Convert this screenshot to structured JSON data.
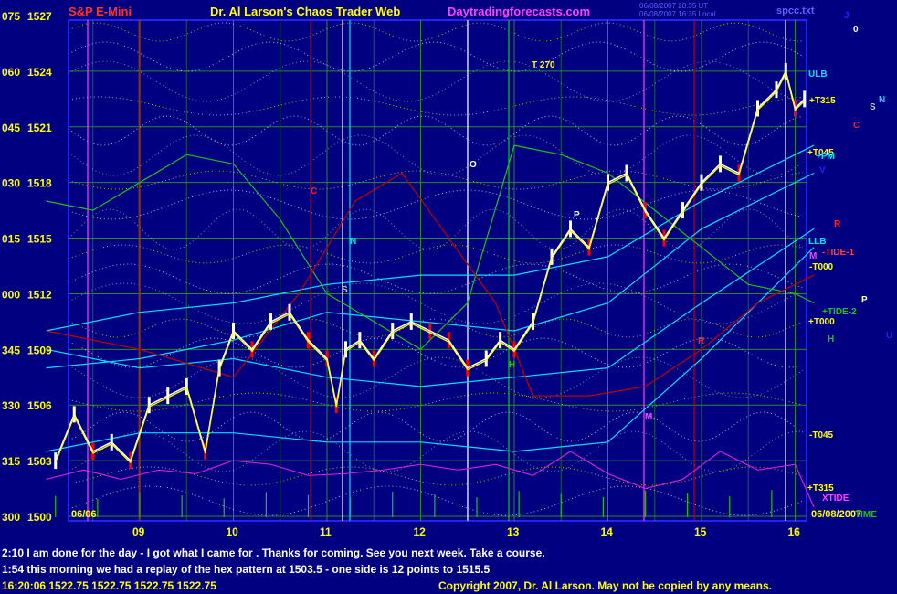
{
  "header": {
    "title_left": "S&P E-Mini",
    "title_center": "Dr. Al Larson's Chaos Trader Web",
    "site": "Daytradingforecasts.com",
    "timestamp_1": "06/08/2007 20:35 UT",
    "timestamp_2": "06/08/2007 16:35 Local",
    "file": "spcc.txt"
  },
  "colors": {
    "background": "#000080",
    "grid_green": "#2a8a2a",
    "axis_blue": "#2222ff",
    "title_red": "#ff3030",
    "title_yellow": "#ffff00",
    "site_magenta": "#ff40ff",
    "price_white": "#ffffff",
    "price_red": "#ff0000",
    "emf_yellow": "#ffff00",
    "tide_cyan": "#00e0ff",
    "tide_green": "#20c020",
    "tide_red": "#c00000",
    "xtide_magenta": "#d020d0"
  },
  "chart_data": {
    "type": "line",
    "title": "S&P E-Mini",
    "ylim": [
      1500,
      1527
    ],
    "y_ticks": [
      {
        "left": "075",
        "price": "1527",
        "value": 1527
      },
      {
        "left": "060",
        "price": "1524",
        "value": 1524
      },
      {
        "left": "045",
        "price": "1521",
        "value": 1521
      },
      {
        "left": "030",
        "price": "1518",
        "value": 1518
      },
      {
        "left": "015",
        "price": "1515",
        "value": 1515
      },
      {
        "left": "000",
        "price": "1512",
        "value": 1512
      },
      {
        "left": "345",
        "price": "1509",
        "value": 1509
      },
      {
        "left": "330",
        "price": "1506",
        "value": 1506
      },
      {
        "left": "315",
        "price": "1503",
        "value": 1503
      },
      {
        "left": "300",
        "price": "1500",
        "value": 1500
      }
    ],
    "x_ticks": [
      "09",
      "10",
      "11",
      "12",
      "13",
      "14",
      "15",
      "16"
    ],
    "date_left": "06/06",
    "date_right": "06/08/2007",
    "right_labels": [
      "ULB",
      "+T315",
      "+T045",
      "+PM",
      "LLB",
      "-TIDE-1",
      "-T000",
      "+TIDE-2",
      "+T000",
      "-T045",
      "+T315",
      "XTIDE",
      "TIME"
    ],
    "planet_glyphs": [
      "J",
      "0",
      "S",
      "N",
      "C",
      "V",
      "R",
      "M",
      "P",
      "U",
      "H"
    ],
    "annotations": [
      "T 270",
      "O",
      "P",
      "N",
      "S",
      "C",
      "R",
      "M",
      "H"
    ],
    "price_series": {
      "name": "S&P E-Mini",
      "hours": [
        8.1,
        8.3,
        8.5,
        8.7,
        8.9,
        9.1,
        9.3,
        9.5,
        9.7,
        9.85,
        10.0,
        10.2,
        10.4,
        10.6,
        10.8,
        11.0,
        11.1,
        11.2,
        11.35,
        11.5,
        11.7,
        11.9,
        12.1,
        12.3,
        12.5,
        12.7,
        12.85,
        13.0,
        13.2,
        13.4,
        13.6,
        13.8,
        14.0,
        14.2,
        14.4,
        14.6,
        14.8,
        15.0,
        15.2,
        15.4,
        15.6,
        15.8,
        15.9,
        16.0,
        16.1
      ],
      "values": [
        1503.0,
        1505.5,
        1503.5,
        1504.0,
        1503.0,
        1506.0,
        1506.5,
        1507.0,
        1503.5,
        1508.0,
        1510.0,
        1509.0,
        1510.5,
        1511.0,
        1509.5,
        1508.5,
        1506.0,
        1509.0,
        1509.5,
        1508.5,
        1510.0,
        1510.5,
        1510.0,
        1509.5,
        1508.0,
        1508.5,
        1509.5,
        1509.0,
        1510.5,
        1514.0,
        1515.5,
        1514.5,
        1518.0,
        1518.5,
        1516.5,
        1515.0,
        1516.5,
        1518.0,
        1519.0,
        1518.5,
        1522.0,
        1523.0,
        1524.0,
        1522.0,
        1522.5
      ]
    },
    "tide_series": [
      {
        "color": "#00e0ff",
        "hours": [
          8.0,
          9.0,
          10.0,
          11.0,
          12.0,
          13.0,
          14.0,
          15.0,
          16.2
        ],
        "values": [
          1509.0,
          1508.0,
          1508.5,
          1507.5,
          1507.0,
          1507.5,
          1508.0,
          1511.5,
          1515.5
        ]
      },
      {
        "color": "#00e0ff",
        "hours": [
          8.0,
          9.0,
          10.0,
          11.0,
          12.0,
          13.0,
          14.0,
          15.0,
          16.2
        ],
        "values": [
          1503.5,
          1504.5,
          1504.5,
          1504.0,
          1504.0,
          1503.5,
          1504.0,
          1508.5,
          1514.5
        ]
      },
      {
        "color": "#00e0ff",
        "hours": [
          8.0,
          9.0,
          10.0,
          11.0,
          12.0,
          13.0,
          14.0,
          15.0,
          16.2
        ],
        "values": [
          1510.0,
          1511.0,
          1511.5,
          1512.5,
          1513.0,
          1513.0,
          1514.0,
          1517.0,
          1520.0
        ]
      },
      {
        "color": "#00e0ff",
        "hours": [
          8.0,
          9.0,
          10.0,
          11.0,
          12.0,
          13.0,
          14.0,
          15.0,
          16.2
        ],
        "values": [
          1508.0,
          1508.5,
          1509.5,
          1511.0,
          1510.5,
          1510.0,
          1511.5,
          1515.5,
          1518.5
        ]
      },
      {
        "color": "#20c020",
        "hours": [
          8.0,
          8.5,
          9.0,
          9.5,
          10.0,
          10.5,
          11.0,
          11.5,
          12.0,
          12.5,
          13.0,
          13.5,
          14.0,
          14.5,
          15.0,
          15.5,
          16.0,
          16.2
        ],
        "values": [
          1517.0,
          1516.5,
          1518.0,
          1519.5,
          1519.0,
          1516.0,
          1512.0,
          1510.5,
          1509.0,
          1511.5,
          1520.0,
          1519.5,
          1518.5,
          1516.5,
          1514.5,
          1512.5,
          1512.0,
          1511.5
        ]
      },
      {
        "color": "#c00000",
        "hours": [
          8.0,
          9.0,
          10.0,
          10.7,
          11.3,
          11.8,
          12.3,
          12.8,
          13.2,
          13.8,
          14.4,
          15.0,
          15.6,
          16.2
        ],
        "values": [
          1510.0,
          1509.0,
          1507.5,
          1512.0,
          1517.0,
          1518.5,
          1515.0,
          1511.5,
          1506.5,
          1506.5,
          1507.0,
          1509.0,
          1511.5,
          1513.0
        ]
      }
    ],
    "xtide": {
      "color": "#d020d0",
      "hours": [
        8.0,
        8.4,
        8.8,
        9.2,
        9.6,
        10.0,
        10.4,
        10.8,
        11.2,
        11.6,
        12.0,
        12.4,
        12.8,
        13.2,
        13.6,
        14.0,
        14.4,
        14.8,
        15.2,
        15.6,
        16.0,
        16.2
      ],
      "values": [
        1502.0,
        1502.5,
        1502.0,
        1502.5,
        1502.3,
        1503.0,
        1502.8,
        1502.2,
        1502.3,
        1502.5,
        1502.8,
        1502.5,
        1502.8,
        1502.2,
        1503.5,
        1502.3,
        1501.5,
        1502.0,
        1503.5,
        1502.5,
        1502.8,
        1500.5
      ]
    }
  },
  "messages": {
    "line1": "2:10 I am done for the day - I got what I came for . Thanks for coming. See you next week. Take a course.",
    "line2": "1:54 this morning we had a replay of the hex pattern at 1503.5 - one side is 12 points to 1515.5"
  },
  "footer": {
    "quote": "16:20:06  1522.75  1522.75  1522.75  1522.75",
    "copyright": "Copyright 2007, Dr. Al Larson. May not be copied by any means."
  }
}
